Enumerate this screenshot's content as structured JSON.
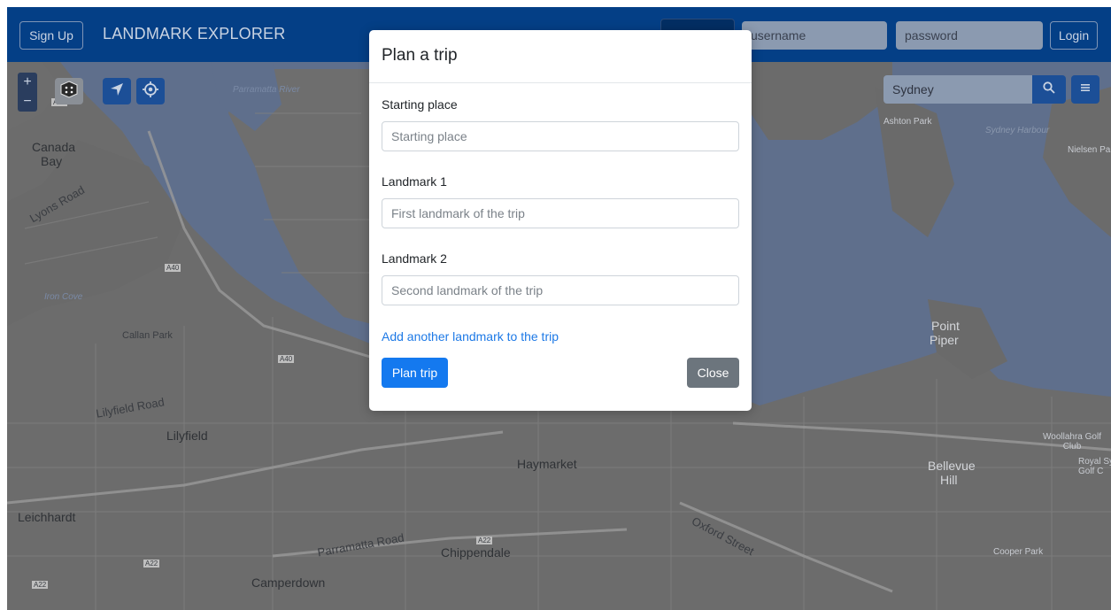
{
  "navbar": {
    "signup_label": "Sign Up",
    "brand": "LANDMARK EXPLORER",
    "username_placeholder": "username",
    "password_placeholder": "password",
    "login_label": "Login"
  },
  "map_controls": {
    "zoom_in": "+",
    "zoom_out": "−",
    "search_value": "Sydney"
  },
  "map_labels": {
    "parramatta_river": "Parramatta River",
    "canada_bay": "Canada Bay",
    "lyons_road": "Lyons Road",
    "iron_cove": "Iron Cove",
    "callan_park": "Callan Park",
    "lilyfield_road": "Lilyfield Road",
    "lilyfield": "Lilyfield",
    "leichhardt": "Leichhardt",
    "parramatta_road": "Parramatta Road",
    "camperdown": "Camperdown",
    "chippendale": "Chippendale",
    "haymarket": "Haymarket",
    "oxford_street": "Oxford Street",
    "ashton_park": "Ashton Park",
    "sydney_harbour": "Sydney Harbour",
    "nielsen_park": "Nielsen Pa",
    "point_piper": "Point Piper",
    "woollahra_golf": "Woollahra Golf Club",
    "royal_golf": "Royal Sy Golf C",
    "bellevue_hill": "Bellevue Hill",
    "cooper_park": "Cooper Park",
    "a40_1": "A40",
    "a40_2": "A40",
    "a40_3": "A40",
    "a22_1": "A22",
    "a22_2": "A22",
    "a22_3": "A22"
  },
  "modal": {
    "title": "Plan a trip",
    "start_label": "Starting place",
    "start_placeholder": "Starting place",
    "landmark1_label": "Landmark 1",
    "landmark1_placeholder": "First landmark of the trip",
    "landmark2_label": "Landmark 2",
    "landmark2_placeholder": "Second landmark of the trip",
    "add_link": "Add another landmark to the trip",
    "plan_button": "Plan trip",
    "close_button": "Close"
  }
}
